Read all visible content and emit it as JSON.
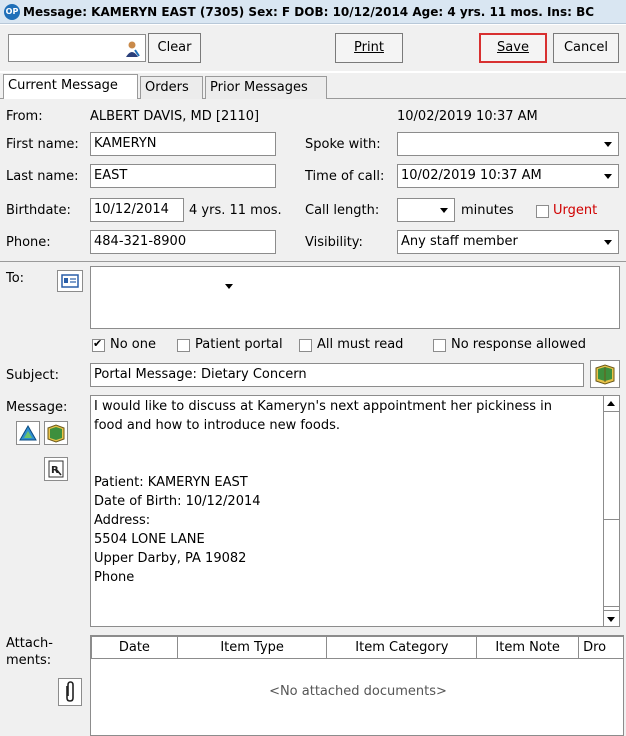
{
  "window": {
    "title": "Message: KAMERYN EAST (7305)  Sex: F  DOB: 10/12/2014  Age: 4 yrs. 11 mos.  Ins: BC",
    "logo": "OP"
  },
  "toolbar": {
    "clear_label": "Clear",
    "print_label": "Print",
    "save_label": "Save",
    "cancel_label": "Cancel"
  },
  "tabs": [
    {
      "label": "Current Message"
    },
    {
      "label": "Orders"
    },
    {
      "label": "Prior Messages"
    }
  ],
  "header": {
    "from_label": "From:",
    "from_value": "ALBERT DAVIS, MD [2110]",
    "datetime": "10/02/2019 10:37 AM"
  },
  "form": {
    "first_name_label": "First name:",
    "first_name": "KAMERYN",
    "last_name_label": "Last name:",
    "last_name": "EAST",
    "birthdate_label": "Birthdate:",
    "birthdate": "10/12/2014",
    "age": "4 yrs. 11 mos.",
    "phone_label": "Phone:",
    "phone": "484-321-8900",
    "spoke_with_label": "Spoke with:",
    "spoke_with": "",
    "time_of_call_label": "Time of call:",
    "time_of_call": "10/02/2019 10:37 AM",
    "call_length_label": "Call length:",
    "call_length": "",
    "minutes_label": "minutes",
    "urgent_label": "Urgent",
    "visibility_label": "Visibility:",
    "visibility": "Any staff member"
  },
  "to": {
    "label": "To:",
    "options": [
      {
        "label": "No one",
        "checked": true
      },
      {
        "label": "Patient portal",
        "checked": false
      },
      {
        "label": "All must read",
        "checked": false
      },
      {
        "label": "No response allowed",
        "checked": false
      }
    ]
  },
  "subject": {
    "label": "Subject:",
    "value": "Portal Message: Dietary Concern"
  },
  "message": {
    "label": "Message:",
    "lines": [
      "I would like to discuss at Kameryn's next appointment her pickiness in",
      "food and how to introduce new foods.",
      "",
      "",
      "Patient: KAMERYN EAST",
      "Date of Birth: 10/12/2014",
      "Address:",
      "5504 LONE LANE",
      "Upper Darby, PA 19082",
      "Phone"
    ]
  },
  "attachments": {
    "label_line1": "Attach-",
    "label_line2": "ments:",
    "columns": [
      "Date",
      "Item Type",
      "Item Category",
      "Item Note",
      "Dro"
    ],
    "empty_text": "<No attached documents>"
  },
  "colors": {
    "accent": "#1f6fb8",
    "urgent": "#d00000",
    "save_border": "#d83030"
  }
}
